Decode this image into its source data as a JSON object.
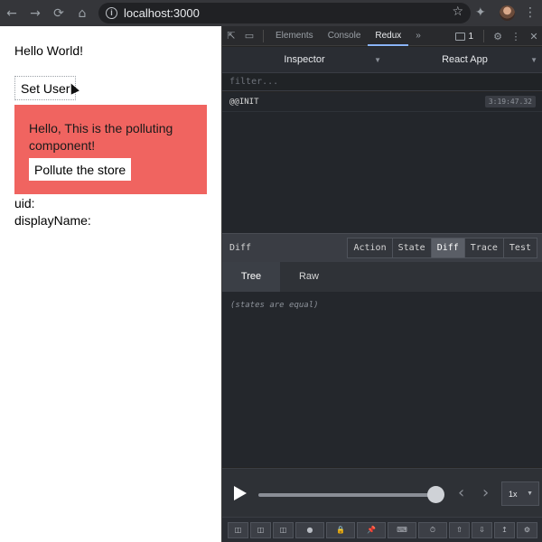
{
  "browser": {
    "url": "localhost:3000",
    "nav_icons": [
      "back-arrow-icon",
      "forward-arrow-icon",
      "reload-icon",
      "home-icon"
    ]
  },
  "page": {
    "greeting": "Hello World!",
    "set_user_label": "Set User",
    "polluter_text": "Hello, This is the polluting component!",
    "pollute_label": "Pollute the store",
    "uid_label": "uid:",
    "display_name_label": "displayName:",
    "polluter_color": "#f06460"
  },
  "devtools": {
    "tabs": [
      "Elements",
      "Console",
      "Redux"
    ],
    "active_tab": "Redux",
    "more": "»",
    "message_count": "1",
    "inspector_label": "Inspector",
    "instance_label": "React App",
    "filter_placeholder": "filter...",
    "actions": [
      {
        "name": "@@INIT",
        "time": "3:19:47.32"
      }
    ],
    "diff_title": "Diff",
    "monitor_tabs": [
      "Action",
      "State",
      "Diff",
      "Trace",
      "Test"
    ],
    "active_monitor_tab": "Diff",
    "view_tabs": [
      "Tree",
      "Raw"
    ],
    "active_view_tab": "Tree",
    "diff_message": "(states are equal)",
    "playback_speed": "1x"
  }
}
